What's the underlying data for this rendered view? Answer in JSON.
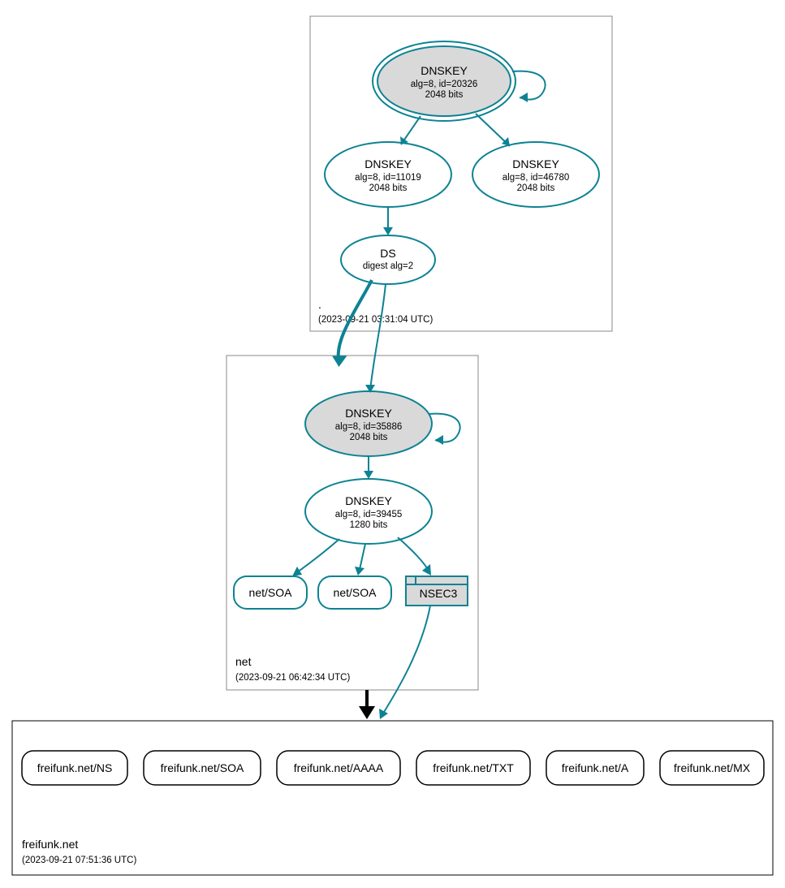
{
  "colors": {
    "teal": "#0d8293",
    "grey": "#d9d9d9"
  },
  "zones": {
    "root": {
      "label": ".",
      "timestamp": "(2023-09-21 03:31:04 UTC)",
      "ksk": {
        "title": "DNSKEY",
        "line1": "alg=8, id=20326",
        "line2": "2048 bits"
      },
      "zsk1": {
        "title": "DNSKEY",
        "line1": "alg=8, id=11019",
        "line2": "2048 bits"
      },
      "zsk2": {
        "title": "DNSKEY",
        "line1": "alg=8, id=46780",
        "line2": "2048 bits"
      },
      "ds": {
        "title": "DS",
        "line1": "digest alg=2"
      }
    },
    "net": {
      "label": "net",
      "timestamp": "(2023-09-21 06:42:34 UTC)",
      "ksk": {
        "title": "DNSKEY",
        "line1": "alg=8, id=35886",
        "line2": "2048 bits"
      },
      "zsk": {
        "title": "DNSKEY",
        "line1": "alg=8, id=39455",
        "line2": "1280 bits"
      },
      "soa1": "net/SOA",
      "soa2": "net/SOA",
      "nsec3": "NSEC3"
    },
    "leaf": {
      "label": "freifunk.net",
      "timestamp": "(2023-09-21 07:51:36 UTC)",
      "records": [
        "freifunk.net/NS",
        "freifunk.net/SOA",
        "freifunk.net/AAAA",
        "freifunk.net/TXT",
        "freifunk.net/A",
        "freifunk.net/MX"
      ]
    }
  }
}
